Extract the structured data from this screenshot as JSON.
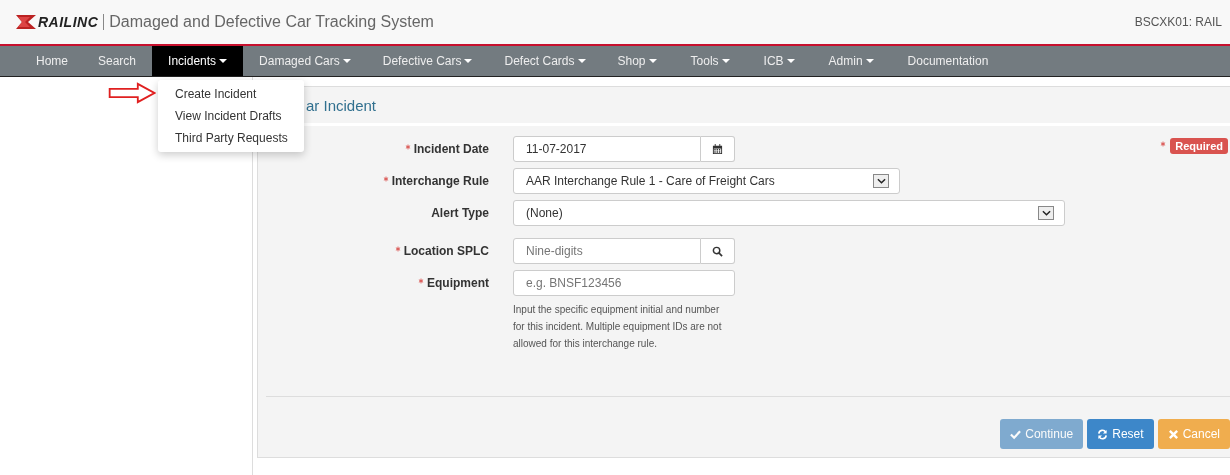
{
  "header": {
    "brand": "RAILINC",
    "title": "Damaged and Defective Car Tracking System",
    "user": "BSCXK01: RAIL"
  },
  "nav": [
    {
      "label": "Home",
      "dropdown": false,
      "selected": false
    },
    {
      "label": "Search",
      "dropdown": false,
      "selected": false
    },
    {
      "label": "Incidents",
      "dropdown": true,
      "selected": true
    },
    {
      "label": "Damaged Cars",
      "dropdown": true,
      "selected": false
    },
    {
      "label": "Defective Cars",
      "dropdown": true,
      "selected": false
    },
    {
      "label": "Defect Cards",
      "dropdown": true,
      "selected": false
    },
    {
      "label": "Shop",
      "dropdown": true,
      "selected": false
    },
    {
      "label": "Tools",
      "dropdown": true,
      "selected": false
    },
    {
      "label": "ICB",
      "dropdown": true,
      "selected": false
    },
    {
      "label": "Admin",
      "dropdown": true,
      "selected": false
    },
    {
      "label": "Documentation",
      "dropdown": false,
      "selected": false
    }
  ],
  "menu": {
    "items": [
      "Create Incident",
      "View Incident Drafts",
      "Third Party Requests"
    ]
  },
  "panel": {
    "title": "ar Incident",
    "required_badge": "Required",
    "fields": [
      {
        "label": "Incident Date",
        "required": true,
        "kind": "date",
        "value": "11-07-2017"
      },
      {
        "label": "Interchange Rule",
        "required": true,
        "kind": "select",
        "value": "AAR Interchange Rule 1 - Care of Freight Cars"
      },
      {
        "label": "Alert Type",
        "required": false,
        "kind": "select",
        "value": "(None)"
      },
      {
        "label": "Location SPLC",
        "required": true,
        "kind": "search",
        "placeholder": "Nine-digits"
      },
      {
        "label": "Equipment",
        "required": true,
        "kind": "text",
        "placeholder": "e.g. BNSF123456",
        "help": "Input the specific equipment initial and number for this incident. Multiple equipment IDs are not allowed for this interchange rule."
      }
    ],
    "buttons": [
      {
        "label": "Continue",
        "kind": "continue",
        "disabled": true
      },
      {
        "label": "Reset",
        "kind": "reset",
        "disabled": false
      },
      {
        "label": "Cancel",
        "kind": "cancel",
        "disabled": false
      }
    ]
  }
}
